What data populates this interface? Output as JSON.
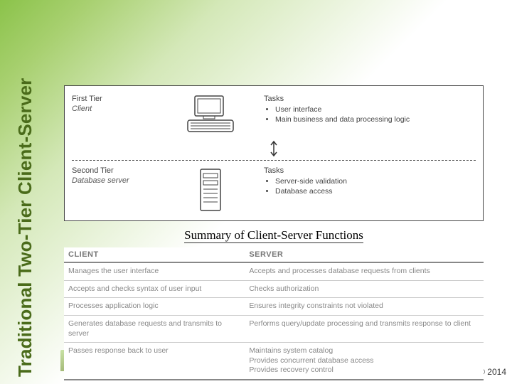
{
  "title": "Traditional Two-Tier Client-Server",
  "copyright": "© 2014",
  "tiers": {
    "first": {
      "label": "First Tier",
      "role": "Client",
      "tasks_label": "Tasks",
      "tasks": [
        "User interface",
        "Main business and data processing logic"
      ]
    },
    "second": {
      "label": "Second Tier",
      "role": "Database server",
      "tasks_label": "Tasks",
      "tasks": [
        "Server-side validation",
        "Database access"
      ]
    }
  },
  "summary": {
    "title": "Summary of Client-Server Functions",
    "headers": {
      "client": "CLIENT",
      "server": "SERVER"
    },
    "rows": [
      {
        "client": "Manages the user interface",
        "server": "Accepts and processes database requests from clients"
      },
      {
        "client": "Accepts and checks syntax of user input",
        "server": "Checks authorization"
      },
      {
        "client": "Processes application logic",
        "server": "Ensures integrity constraints not violated"
      },
      {
        "client": "Generates database requests and transmits to server",
        "server": "Performs query/update processing and transmits response to client"
      },
      {
        "client": "Passes response back to user",
        "server": "Maintains system catalog\nProvides concurrent database access\nProvides recovery control"
      }
    ]
  }
}
